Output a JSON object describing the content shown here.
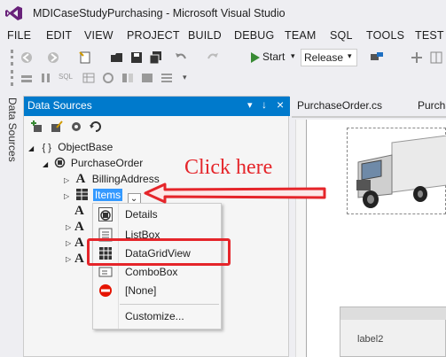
{
  "window": {
    "title": "MDICaseStudyPurchasing - Microsoft Visual Studio"
  },
  "menu": [
    "FILE",
    "EDIT",
    "VIEW",
    "PROJECT",
    "BUILD",
    "DEBUG",
    "TEAM",
    "SQL",
    "TOOLS",
    "TEST"
  ],
  "toolbar": {
    "start_label": "Start",
    "config_value": "Release",
    "sql_label": "SQL"
  },
  "side_tab": {
    "label": "Data Sources"
  },
  "panel": {
    "title": "Data Sources",
    "pin_glyph": "↓",
    "close_glyph": "×",
    "dropdown_glyph": "▾"
  },
  "tree": {
    "root": "ObjectBase",
    "root_icon_text": "{ }",
    "purchase_order": "PurchaseOrder",
    "billing_address": "BillingAddress",
    "items": "Items"
  },
  "dropdown": {
    "items": [
      "Details",
      "ListBox",
      "DataGridView",
      "ComboBox",
      "[None]",
      "Customize..."
    ]
  },
  "annotation": {
    "text": "Click here",
    "color": "#e5252a"
  },
  "editor": {
    "tab_label": "PurchaseOrder.cs",
    "tab2_label": "Purchas",
    "form_label": "label2"
  },
  "colors": {
    "accent": "#007acc",
    "highlight_box": "#e5252a",
    "selection": "#3399ff"
  }
}
